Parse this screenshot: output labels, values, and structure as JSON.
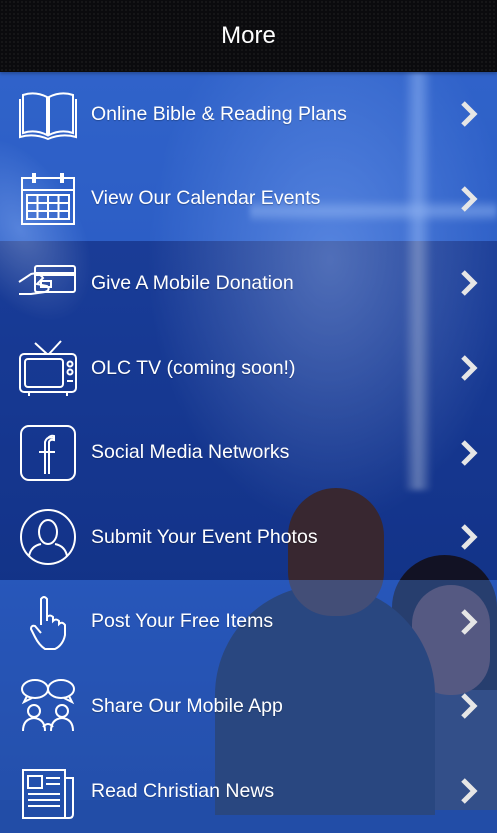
{
  "header": {
    "title": "More"
  },
  "menu": {
    "items": [
      {
        "label": "Online Bible & Reading Plans",
        "icon": "open-book-icon"
      },
      {
        "label": "View Our Calendar Events",
        "icon": "calendar-icon"
      },
      {
        "label": "Give A Mobile Donation",
        "icon": "credit-card-hand-icon"
      },
      {
        "label": "OLC TV (coming soon!)",
        "icon": "tv-icon"
      },
      {
        "label": "Social Media Networks",
        "icon": "facebook-icon"
      },
      {
        "label": "Submit Your Event Photos",
        "icon": "user-profile-icon"
      },
      {
        "label": "Post Your Free Items",
        "icon": "pointing-hand-icon"
      },
      {
        "label": "Share Our Mobile App",
        "icon": "group-chat-icon"
      },
      {
        "label": "Read Christian News",
        "icon": "newspaper-icon"
      }
    ]
  },
  "colors": {
    "header_bg": "#0b0b0e",
    "accent": "#1d46a8",
    "text": "#ffffff"
  }
}
